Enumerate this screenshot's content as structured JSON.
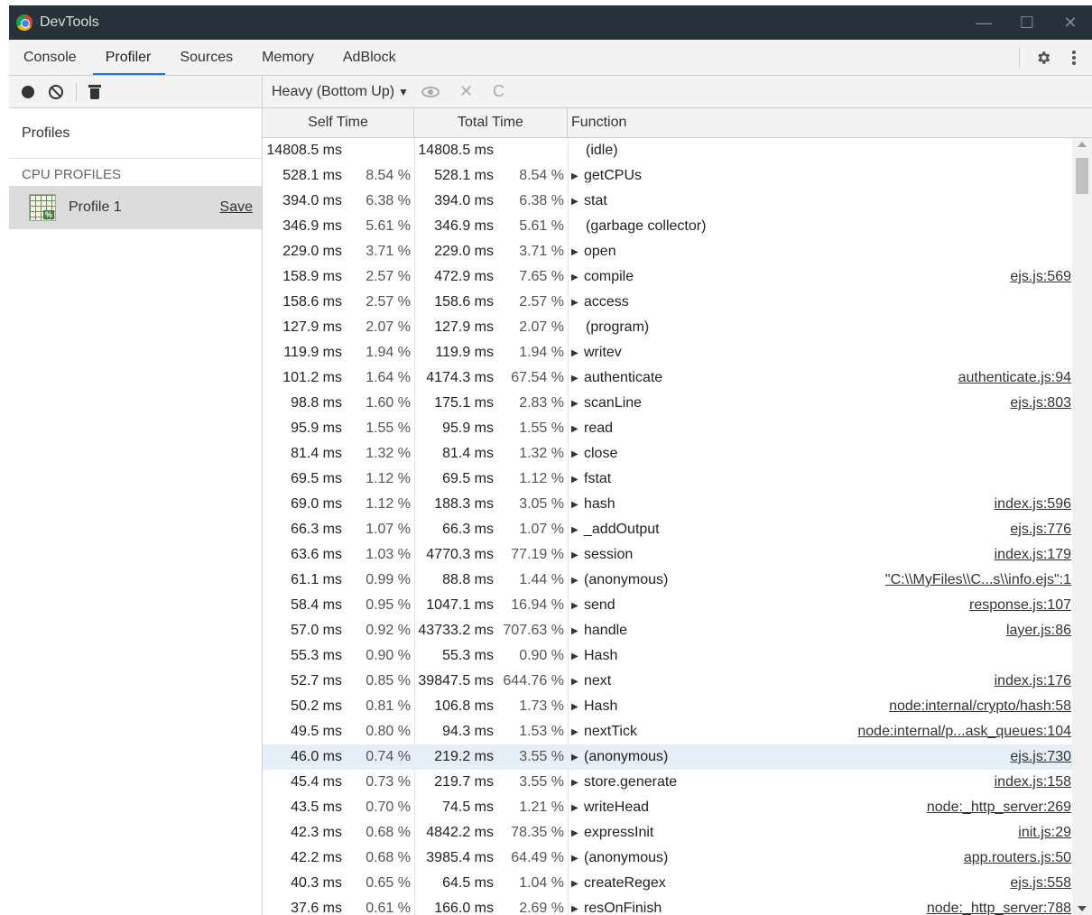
{
  "window": {
    "title": "DevTools",
    "controls": [
      "—",
      "☐",
      "✕"
    ]
  },
  "tabs": [
    {
      "label": "Console"
    },
    {
      "label": "Profiler",
      "active": true
    },
    {
      "label": "Sources"
    },
    {
      "label": "Memory"
    },
    {
      "label": "AdBlock"
    }
  ],
  "toolbar": {
    "view_mode": "Heavy (Bottom Up)",
    "caret": "▼",
    "close_glyph": "✕",
    "reload_glyph": "C"
  },
  "sidebar": {
    "profiles_label": "Profiles",
    "section_label": "CPU PROFILES",
    "profile_name": "Profile 1",
    "save_label": "Save",
    "profile_icon_badge": "%"
  },
  "columns": {
    "self": "Self Time",
    "total": "Total Time",
    "function": "Function"
  },
  "rows": [
    {
      "self": "14808.5 ms",
      "self_pct": "",
      "total": "14808.5 ms",
      "total_pct": "",
      "fn": "(idle)",
      "expandable": false,
      "src": ""
    },
    {
      "self": "528.1 ms",
      "self_pct": "8.54 %",
      "total": "528.1 ms",
      "total_pct": "8.54 %",
      "fn": "getCPUs",
      "expandable": true,
      "src": ""
    },
    {
      "self": "394.0 ms",
      "self_pct": "6.38 %",
      "total": "394.0 ms",
      "total_pct": "6.38 %",
      "fn": "stat",
      "expandable": true,
      "src": ""
    },
    {
      "self": "346.9 ms",
      "self_pct": "5.61 %",
      "total": "346.9 ms",
      "total_pct": "5.61 %",
      "fn": "(garbage collector)",
      "expandable": false,
      "src": ""
    },
    {
      "self": "229.0 ms",
      "self_pct": "3.71 %",
      "total": "229.0 ms",
      "total_pct": "3.71 %",
      "fn": "open",
      "expandable": true,
      "src": ""
    },
    {
      "self": "158.9 ms",
      "self_pct": "2.57 %",
      "total": "472.9 ms",
      "total_pct": "7.65 %",
      "fn": "compile",
      "expandable": true,
      "src": "ejs.js:569"
    },
    {
      "self": "158.6 ms",
      "self_pct": "2.57 %",
      "total": "158.6 ms",
      "total_pct": "2.57 %",
      "fn": "access",
      "expandable": true,
      "src": ""
    },
    {
      "self": "127.9 ms",
      "self_pct": "2.07 %",
      "total": "127.9 ms",
      "total_pct": "2.07 %",
      "fn": "(program)",
      "expandable": false,
      "src": ""
    },
    {
      "self": "119.9 ms",
      "self_pct": "1.94 %",
      "total": "119.9 ms",
      "total_pct": "1.94 %",
      "fn": "writev",
      "expandable": true,
      "src": ""
    },
    {
      "self": "101.2 ms",
      "self_pct": "1.64 %",
      "total": "4174.3 ms",
      "total_pct": "67.54 %",
      "fn": "authenticate",
      "expandable": true,
      "src": "authenticate.js:94"
    },
    {
      "self": "98.8 ms",
      "self_pct": "1.60 %",
      "total": "175.1 ms",
      "total_pct": "2.83 %",
      "fn": "scanLine",
      "expandable": true,
      "src": "ejs.js:803"
    },
    {
      "self": "95.9 ms",
      "self_pct": "1.55 %",
      "total": "95.9 ms",
      "total_pct": "1.55 %",
      "fn": "read",
      "expandable": true,
      "src": ""
    },
    {
      "self": "81.4 ms",
      "self_pct": "1.32 %",
      "total": "81.4 ms",
      "total_pct": "1.32 %",
      "fn": "close",
      "expandable": true,
      "src": ""
    },
    {
      "self": "69.5 ms",
      "self_pct": "1.12 %",
      "total": "69.5 ms",
      "total_pct": "1.12 %",
      "fn": "fstat",
      "expandable": true,
      "src": ""
    },
    {
      "self": "69.0 ms",
      "self_pct": "1.12 %",
      "total": "188.3 ms",
      "total_pct": "3.05 %",
      "fn": "hash",
      "expandable": true,
      "src": "index.js:596"
    },
    {
      "self": "66.3 ms",
      "self_pct": "1.07 %",
      "total": "66.3 ms",
      "total_pct": "1.07 %",
      "fn": "_addOutput",
      "expandable": true,
      "src": "ejs.js:776"
    },
    {
      "self": "63.6 ms",
      "self_pct": "1.03 %",
      "total": "4770.3 ms",
      "total_pct": "77.19 %",
      "fn": "session",
      "expandable": true,
      "src": "index.js:179"
    },
    {
      "self": "61.1 ms",
      "self_pct": "0.99 %",
      "total": "88.8 ms",
      "total_pct": "1.44 %",
      "fn": "(anonymous)",
      "expandable": true,
      "src": "\"C:\\\\MyFiles\\\\C...s\\\\info.ejs\":1"
    },
    {
      "self": "58.4 ms",
      "self_pct": "0.95 %",
      "total": "1047.1 ms",
      "total_pct": "16.94 %",
      "fn": "send",
      "expandable": true,
      "src": "response.js:107"
    },
    {
      "self": "57.0 ms",
      "self_pct": "0.92 %",
      "total": "43733.2 ms",
      "total_pct": "707.63 %",
      "fn": "handle",
      "expandable": true,
      "src": "layer.js:86"
    },
    {
      "self": "55.3 ms",
      "self_pct": "0.90 %",
      "total": "55.3 ms",
      "total_pct": "0.90 %",
      "fn": "Hash",
      "expandable": true,
      "src": ""
    },
    {
      "self": "52.7 ms",
      "self_pct": "0.85 %",
      "total": "39847.5 ms",
      "total_pct": "644.76 %",
      "fn": "next",
      "expandable": true,
      "src": "index.js:176"
    },
    {
      "self": "50.2 ms",
      "self_pct": "0.81 %",
      "total": "106.8 ms",
      "total_pct": "1.73 %",
      "fn": "Hash",
      "expandable": true,
      "src": "node:internal/crypto/hash:58"
    },
    {
      "self": "49.5 ms",
      "self_pct": "0.80 %",
      "total": "94.3 ms",
      "total_pct": "1.53 %",
      "fn": "nextTick",
      "expandable": true,
      "src": "node:internal/p...ask_queues:104"
    },
    {
      "self": "46.0 ms",
      "self_pct": "0.74 %",
      "total": "219.2 ms",
      "total_pct": "3.55 %",
      "fn": "(anonymous)",
      "expandable": true,
      "src": "ejs.js:730",
      "selected": true
    },
    {
      "self": "45.4 ms",
      "self_pct": "0.73 %",
      "total": "219.7 ms",
      "total_pct": "3.55 %",
      "fn": "store.generate",
      "expandable": true,
      "src": "index.js:158"
    },
    {
      "self": "43.5 ms",
      "self_pct": "0.70 %",
      "total": "74.5 ms",
      "total_pct": "1.21 %",
      "fn": "writeHead",
      "expandable": true,
      "src": "node:_http_server:269"
    },
    {
      "self": "42.3 ms",
      "self_pct": "0.68 %",
      "total": "4842.2 ms",
      "total_pct": "78.35 %",
      "fn": "expressInit",
      "expandable": true,
      "src": "init.js:29"
    },
    {
      "self": "42.2 ms",
      "self_pct": "0.68 %",
      "total": "3985.4 ms",
      "total_pct": "64.49 %",
      "fn": "(anonymous)",
      "expandable": true,
      "src": "app.routers.js:50"
    },
    {
      "self": "40.3 ms",
      "self_pct": "0.65 %",
      "total": "64.5 ms",
      "total_pct": "1.04 %",
      "fn": "createRegex",
      "expandable": true,
      "src": "ejs.js:558"
    },
    {
      "self": "37.6 ms",
      "self_pct": "0.61 %",
      "total": "166.0 ms",
      "total_pct": "2.69 %",
      "fn": "resOnFinish",
      "expandable": true,
      "src": "node:_http_server:788"
    }
  ],
  "colors": {
    "accent": "#1a73e8",
    "titlebar": "#263238",
    "selected_row": "#e6eef8"
  }
}
